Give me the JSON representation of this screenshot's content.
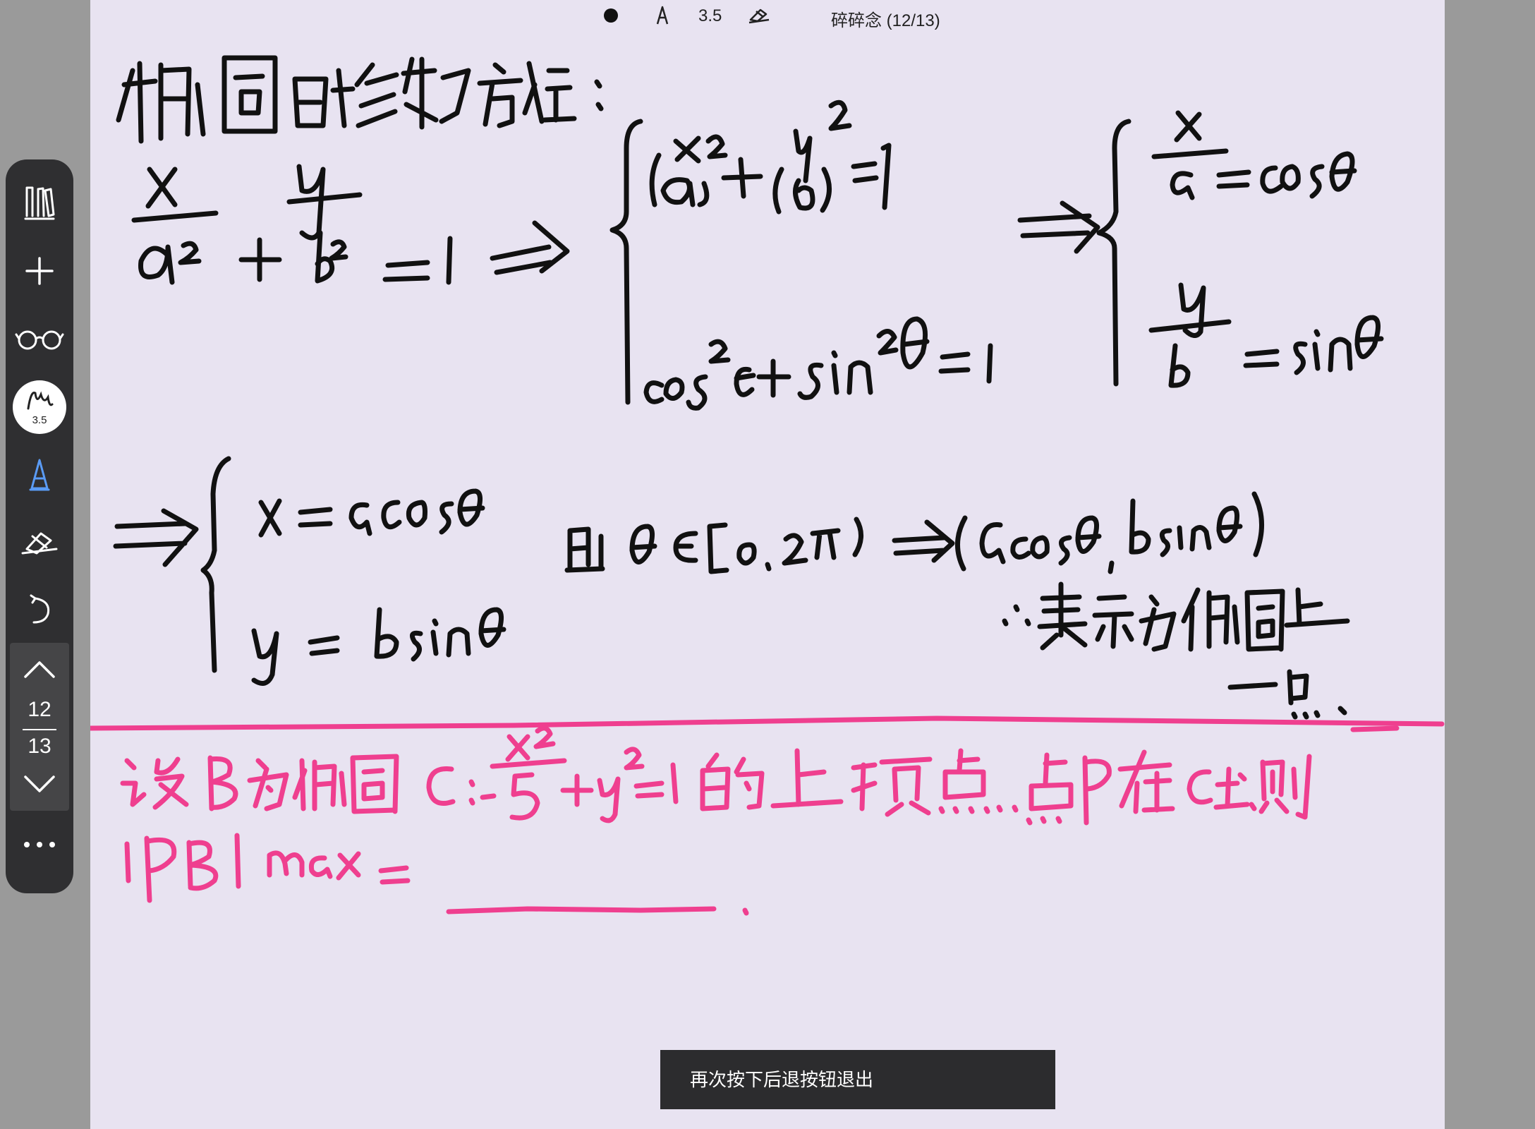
{
  "status_bar": {
    "pen_size": "3.5",
    "document_title": "碎碎念 (12/13)"
  },
  "toolbar": {
    "items": [
      {
        "icon": "notebooks-icon"
      },
      {
        "icon": "add-icon"
      },
      {
        "icon": "glasses-icon"
      },
      {
        "icon": "brush-icon"
      },
      {
        "icon": "pen-icon"
      },
      {
        "icon": "eraser-icon"
      },
      {
        "icon": "undo-icon"
      }
    ],
    "brush_size": "3.5",
    "pager": {
      "current_page": "12",
      "total_pages": "13"
    },
    "more_icon": "more-icon"
  },
  "toast": {
    "message": "再次按下后退按钮退出"
  },
  "ink_colors": {
    "black_ink": "#111111",
    "pink_ink": "#ef3f8f",
    "page_background": "#e8e3f1"
  }
}
